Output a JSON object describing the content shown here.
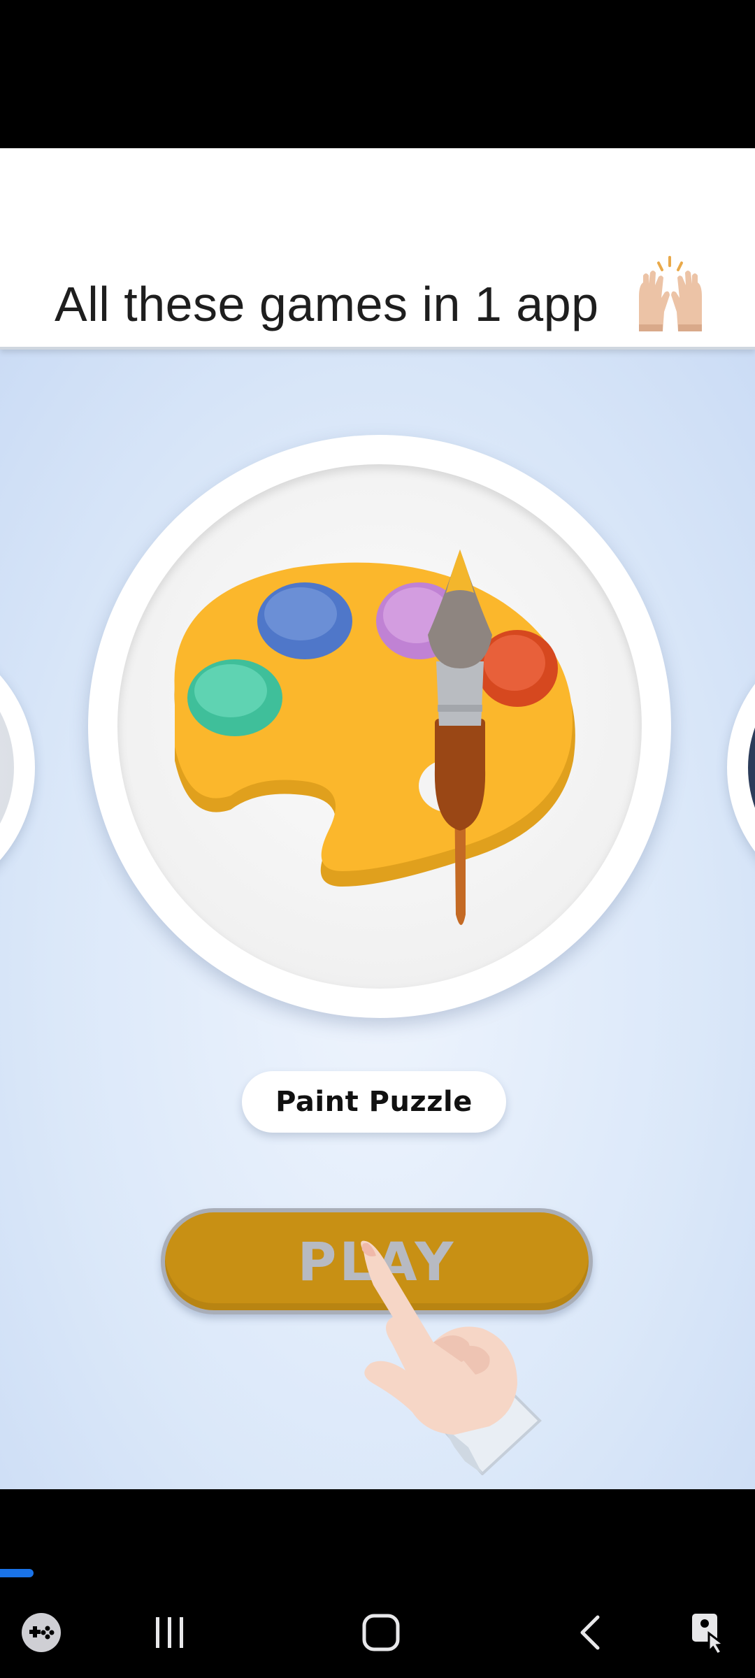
{
  "header": {
    "headline": "All these games in 1 app",
    "emoji_icon": "raising-hands-icon"
  },
  "carousel": {
    "current_game": {
      "name": "Paint Puzzle",
      "icon": "paint-palette-icon"
    },
    "play_button_label": "PLAY"
  },
  "colors": {
    "play_button": "#c89014",
    "palette": "#fbb72c",
    "progress": "#1a73e8"
  },
  "nav_bar": {
    "items": [
      "game-tools-icon",
      "recents-icon",
      "home-icon",
      "back-icon",
      "accessibility-icon"
    ]
  }
}
